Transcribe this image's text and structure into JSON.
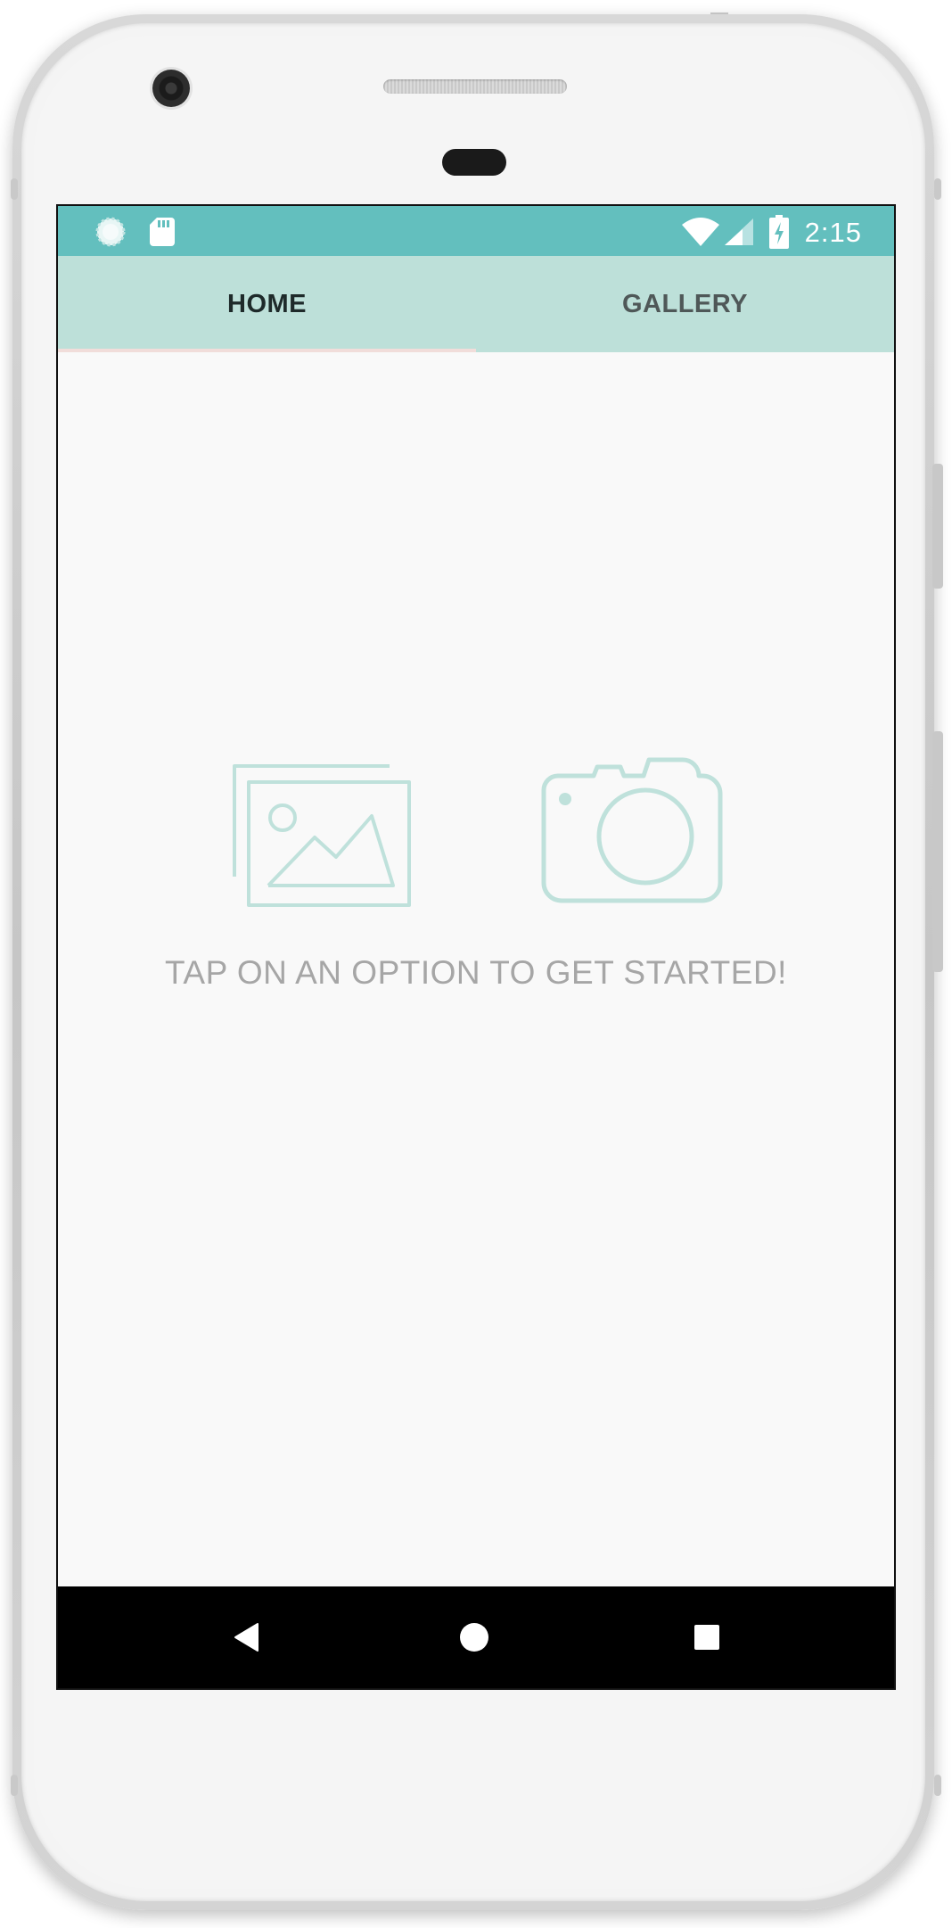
{
  "status_bar": {
    "time": "2:15",
    "background_color": "#63bfbe",
    "left_icons": [
      "loading-spinner-icon",
      "sd-card-icon"
    ],
    "right_icons": [
      "wifi-icon",
      "cell-signal-icon",
      "battery-charging-icon"
    ]
  },
  "tabs": [
    {
      "label": "HOME",
      "selected": true
    },
    {
      "label": "GALLERY",
      "selected": false
    }
  ],
  "tab_bar_color": "#bde0d9",
  "main": {
    "options": [
      {
        "icon": "gallery-image-icon"
      },
      {
        "icon": "camera-icon"
      }
    ],
    "hint": "TAP ON AN OPTION TO GET STARTED!",
    "accent_color": "#bfe1db"
  },
  "navigation_bar": {
    "buttons": [
      "back-icon",
      "home-icon",
      "recents-icon"
    ]
  }
}
